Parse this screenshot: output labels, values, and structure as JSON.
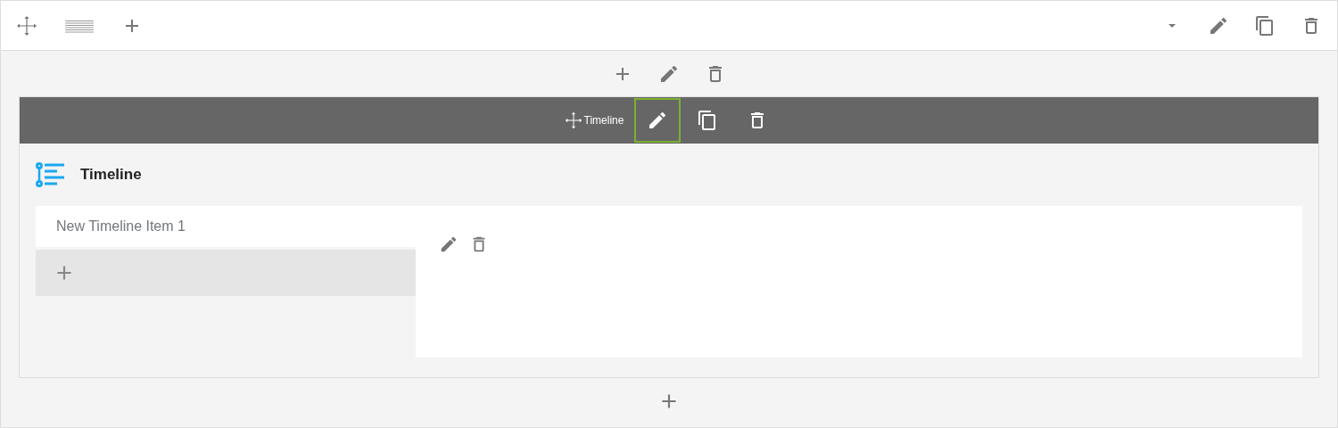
{
  "top_toolbar": {
    "left": [
      {
        "kind": "move"
      },
      {
        "kind": "layout"
      },
      {
        "kind": "add"
      }
    ],
    "right": [
      {
        "kind": "caret"
      },
      {
        "kind": "edit"
      },
      {
        "kind": "copy"
      },
      {
        "kind": "delete"
      }
    ]
  },
  "section_tools": [
    {
      "kind": "add"
    },
    {
      "kind": "edit"
    },
    {
      "kind": "delete"
    }
  ],
  "element": {
    "label": "Timeline",
    "tools": [
      {
        "kind": "edit",
        "focused": true
      },
      {
        "kind": "copy",
        "focused": false
      },
      {
        "kind": "delete",
        "focused": false
      }
    ],
    "heading": "Timeline",
    "items": [
      {
        "label": "New Timeline Item 1",
        "selected": true
      }
    ],
    "item_tools": [
      {
        "kind": "edit"
      },
      {
        "kind": "delete"
      }
    ]
  },
  "bottom_tools": [
    {
      "kind": "add"
    }
  ]
}
